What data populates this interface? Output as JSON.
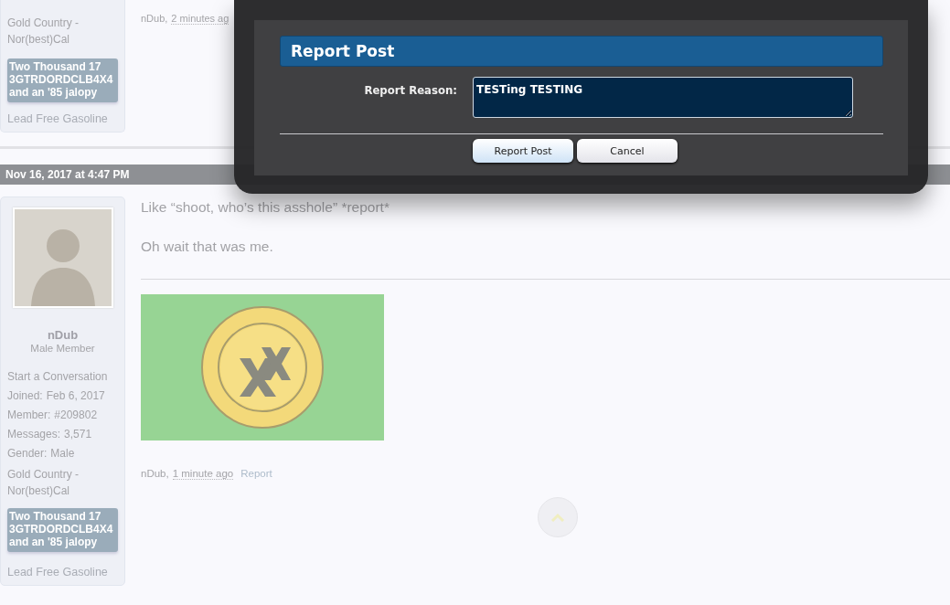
{
  "top_post": {
    "sidebar": {
      "location": "Gold Country - Nor(best)Cal",
      "banner": "Two Thousand 17 3GTRDORDCLB4X4 and an '85 jalopy",
      "signature_line": "Lead Free Gasoline"
    },
    "footer": {
      "author": "nDub,",
      "time": "2 minutes ag"
    }
  },
  "date_bar": "Nov 16, 2017 at 4:47 PM",
  "post": {
    "sidebar": {
      "username": "nDub",
      "user_title": "Male Member",
      "start_conversation": "Start a Conversation",
      "stats": [
        {
          "label": "Joined:",
          "value": "Feb 6, 2017"
        },
        {
          "label": "Member:",
          "value": "#209802"
        },
        {
          "label": "Messages:",
          "value": "3,571"
        },
        {
          "label": "Gender:",
          "value": "Male"
        }
      ],
      "location": "Gold Country - Nor(best)Cal",
      "banner": "Two Thousand 17 3GTRDORDCLB4X4 and an '85 jalopy",
      "signature_line": "Lead Free Gasoline"
    },
    "message": [
      "Like “shoot, who’s this asshole” *report*",
      "Oh wait that was me."
    ],
    "footer": {
      "author": "nDub,",
      "time": "1 minute ago",
      "report": "Report"
    }
  },
  "modal": {
    "title": "Report Post",
    "field_label": "Report Reason:",
    "field_value": "TESTing TESTING",
    "buttons": [
      "Report Post",
      "Cancel"
    ]
  }
}
